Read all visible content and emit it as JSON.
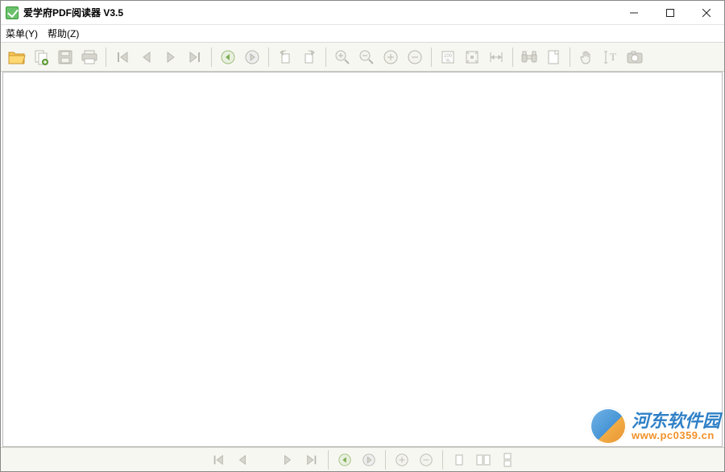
{
  "app": {
    "title": "爱学府PDF阅读器 V3.5"
  },
  "menubar": {
    "menu": "菜单(Y)",
    "help": "帮助(Z)"
  },
  "toolbar": {
    "open": "open",
    "copy": "copy",
    "save": "save",
    "print": "print",
    "first": "first-page",
    "prev": "prev-page",
    "next": "next-page",
    "last": "last-page",
    "back": "back",
    "forward": "forward",
    "rotL": "rotate-left",
    "rotR": "rotate-right",
    "zoomIn": "zoom-in",
    "zoomOut": "zoom-out",
    "zoomInArea": "zoom-in-area",
    "zoomOutArea": "zoom-out-area",
    "actual": "actual-size",
    "fitPage": "fit-page",
    "fitWidth": "fit-width",
    "find": "find",
    "bookmarks": "bookmarks",
    "hand": "hand-tool",
    "textSel": "text-select",
    "snapshot": "snapshot"
  },
  "zoom_percent_label": "100%",
  "watermark": {
    "name": "河东软件园",
    "url": "www.pc0359.cn"
  }
}
